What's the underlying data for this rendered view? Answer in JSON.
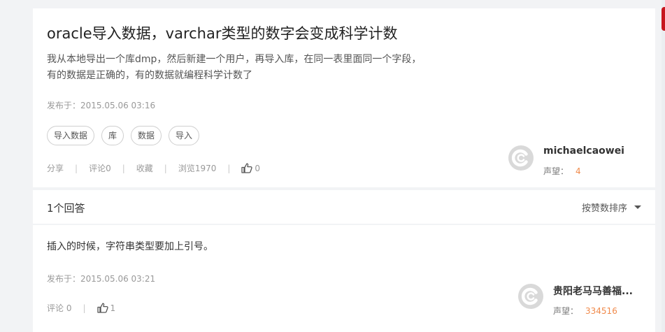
{
  "question": {
    "title": "oracle导入数据，varchar类型的数字会变成科学计数",
    "body_line1": "我从本地导出一个库dmp，然后新建一个用户，再导入库，在同一表里面同一个字段，",
    "body_line2": "有的数据是正确的，有的数据就编程科学计数了",
    "published": "发布于：2015.05.06 03:16",
    "tags": [
      "导入数据",
      "库",
      "数据",
      "导入"
    ],
    "actions": {
      "share": "分享",
      "comment": "评论0",
      "favorite": "收藏",
      "views": "浏览1970",
      "likes": "0"
    },
    "author": {
      "name": "michaelcaowei",
      "reputation_label": "声望：",
      "reputation": "4"
    }
  },
  "answers_header": {
    "count_label": "1个回答",
    "sort_label": "按赞数排序"
  },
  "answer": {
    "text": "插入的时候，字符串类型要加上引号。",
    "published": "发布于：2015.05.06 03:21",
    "comment": "评论 0",
    "likes": "1",
    "author": {
      "name": "贵阳老马马善福...",
      "reputation_label": "声望：",
      "reputation": "334516"
    }
  },
  "colors": {
    "accent_orange": "#f08a4b",
    "brand_red": "#c7161e"
  },
  "icons": [
    "thumbs-up-icon",
    "avatar-c-logo-icon",
    "caret-down-icon"
  ]
}
